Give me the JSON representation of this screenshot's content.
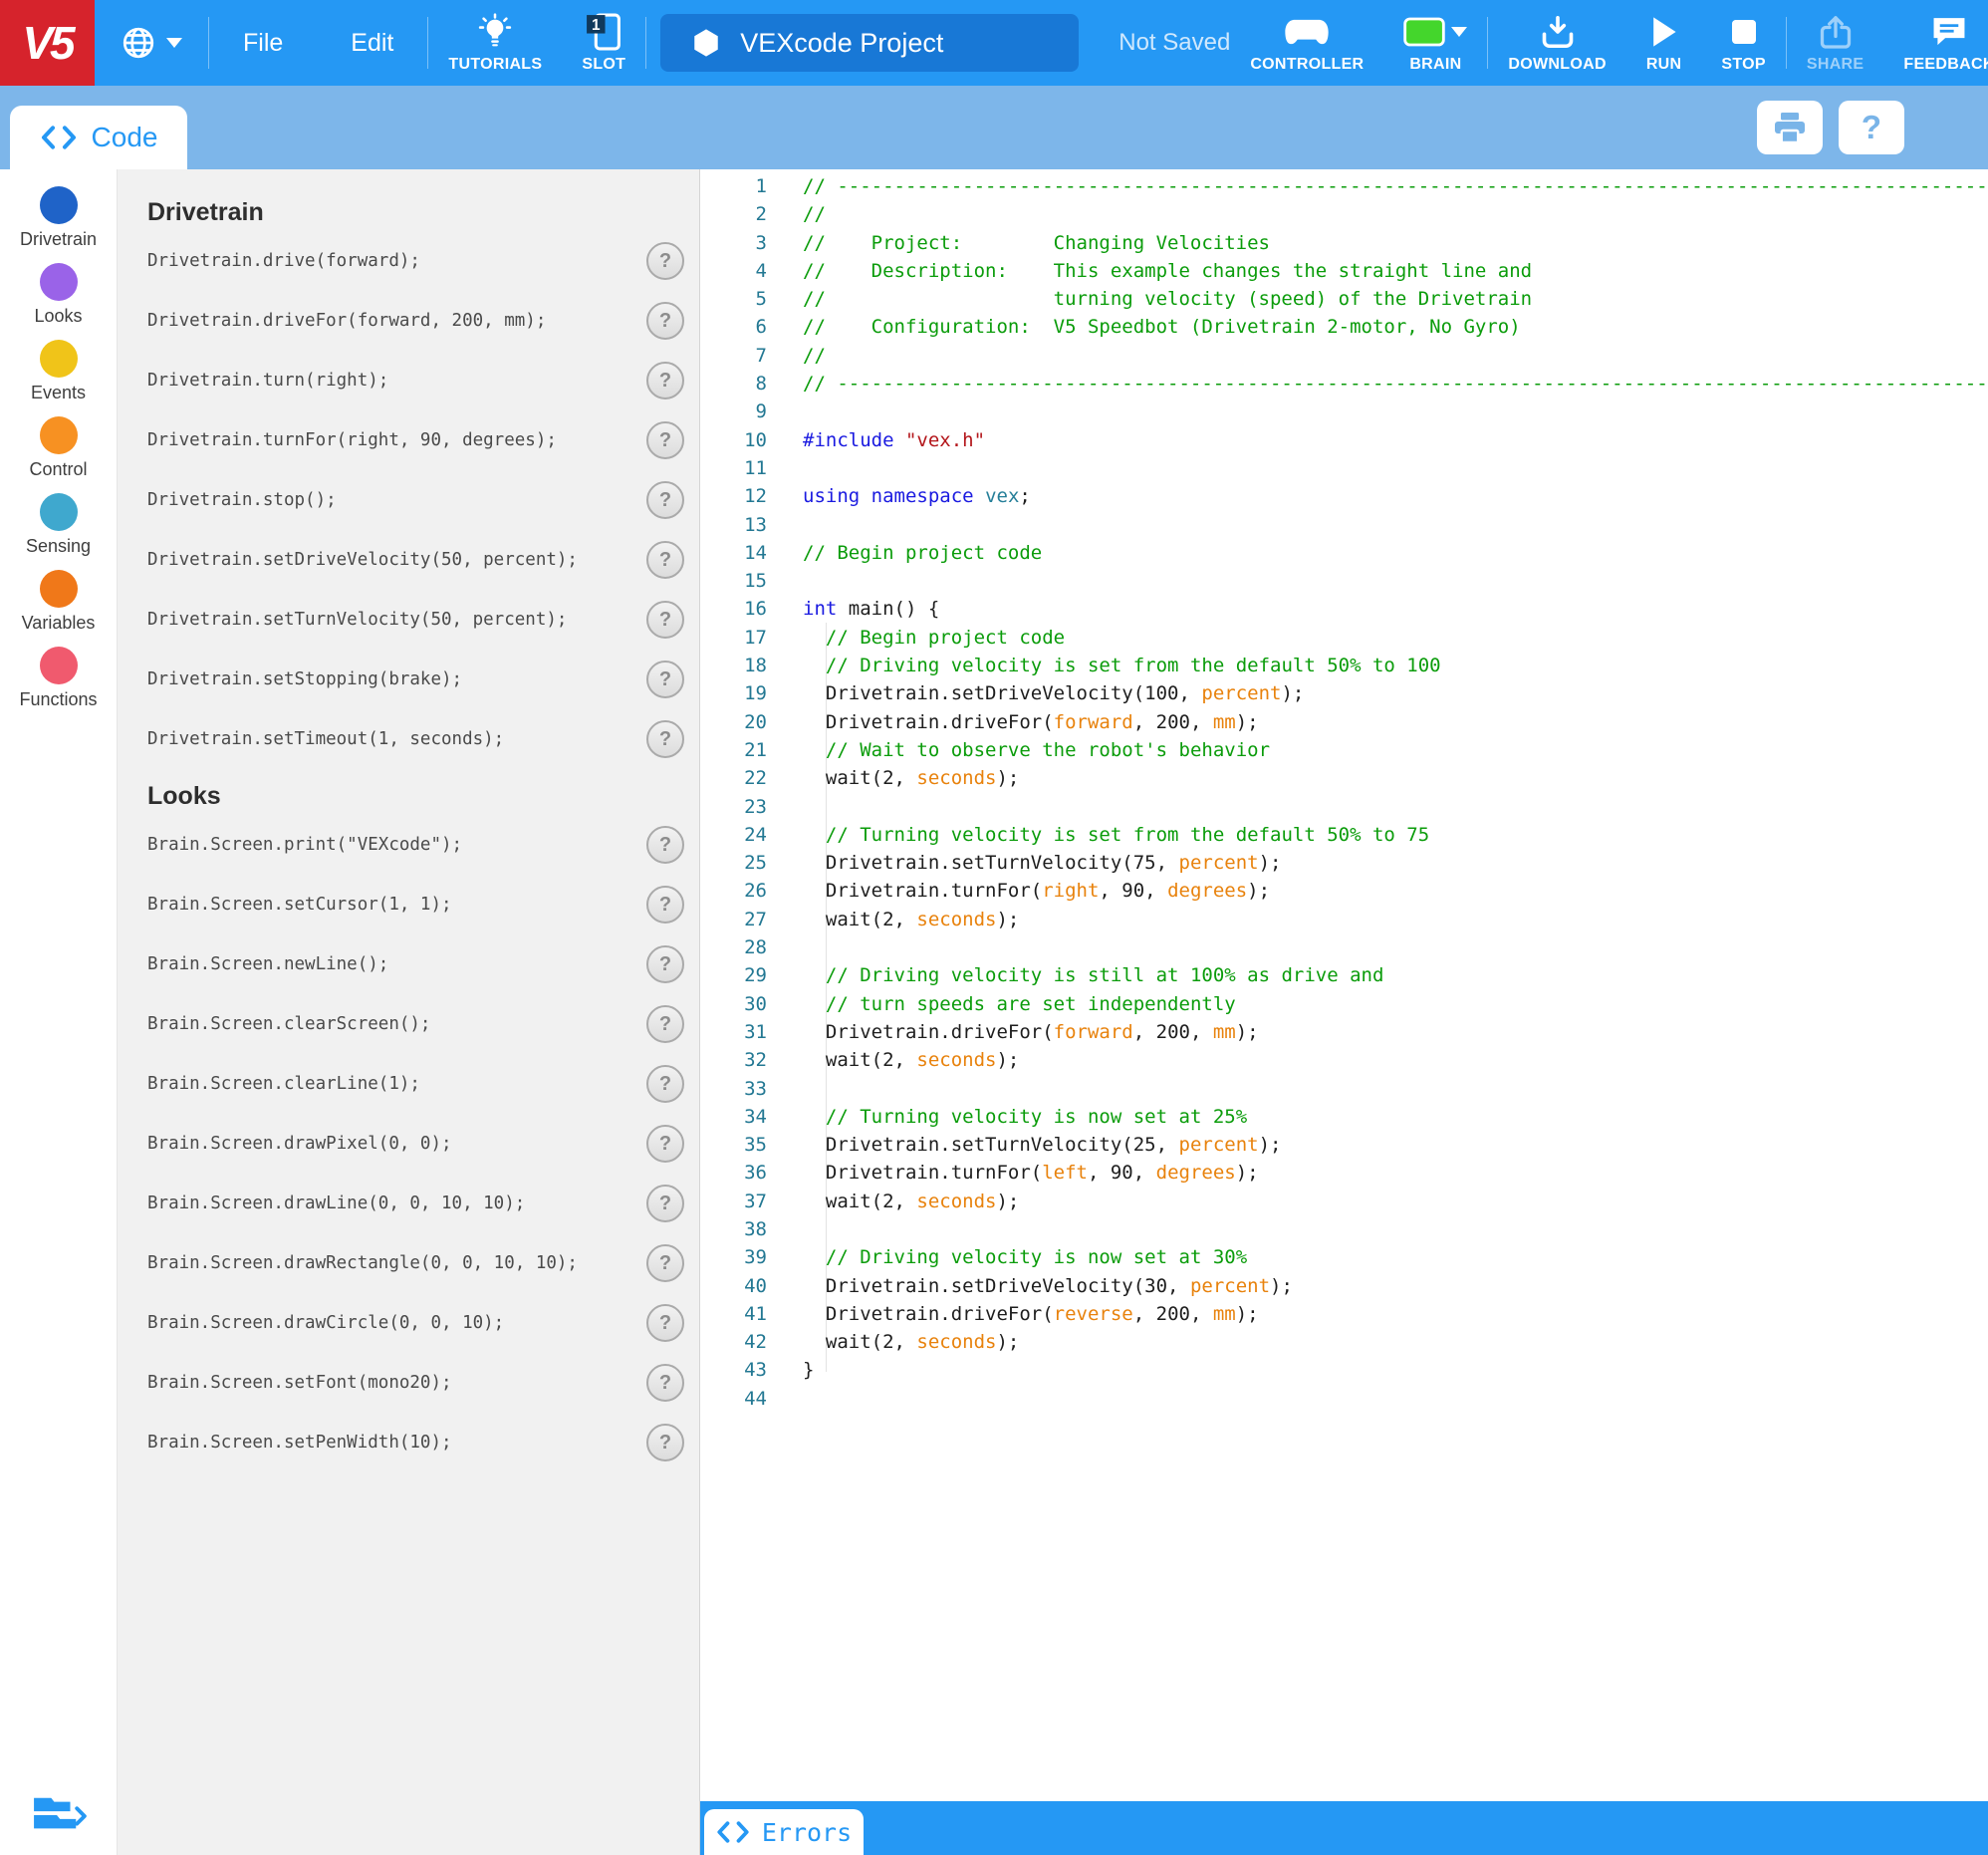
{
  "toolbar": {
    "logo": "V5",
    "menus": {
      "file": "File",
      "edit": "Edit"
    },
    "tutorials_label": "TUTORIALS",
    "slot": {
      "label": "SLOT",
      "number": "1"
    },
    "project": {
      "name": "VEXcode Project"
    },
    "save_status": "Not Saved",
    "controller_label": "CONTROLLER",
    "brain_label": "BRAIN",
    "download_label": "DOWNLOAD",
    "run_label": "RUN",
    "stop_label": "STOP",
    "share_label": "SHARE",
    "feedback_label": "FEEDBACK"
  },
  "tabs": {
    "code": "Code",
    "errors": "Errors"
  },
  "subbar": {
    "help_glyph": "?"
  },
  "sidebar": {
    "categories": [
      {
        "label": "Drivetrain",
        "color": "#1F63C8"
      },
      {
        "label": "Looks",
        "color": "#9A63E8"
      },
      {
        "label": "Events",
        "color": "#F0C419"
      },
      {
        "label": "Control",
        "color": "#F79122"
      },
      {
        "label": "Sensing",
        "color": "#3FA8CE"
      },
      {
        "label": "Variables",
        "color": "#F07819"
      },
      {
        "label": "Functions",
        "color": "#F05A6E"
      }
    ]
  },
  "command_panel": {
    "help_glyph": "?",
    "sections": [
      {
        "title": "Drivetrain",
        "commands": [
          "Drivetrain.drive(forward);",
          "Drivetrain.driveFor(forward, 200, mm);",
          "Drivetrain.turn(right);",
          "Drivetrain.turnFor(right, 90, degrees);",
          "Drivetrain.stop();",
          "Drivetrain.setDriveVelocity(50, percent);",
          "Drivetrain.setTurnVelocity(50, percent);",
          "Drivetrain.setStopping(brake);",
          "Drivetrain.setTimeout(1, seconds);"
        ]
      },
      {
        "title": "Looks",
        "commands": [
          "Brain.Screen.print(\"VEXcode\");",
          "Brain.Screen.setCursor(1, 1);",
          "Brain.Screen.newLine();",
          "Brain.Screen.clearScreen();",
          "Brain.Screen.clearLine(1);",
          "Brain.Screen.drawPixel(0, 0);",
          "Brain.Screen.drawLine(0, 0, 10, 10);",
          "Brain.Screen.drawRectangle(0, 0, 10, 10);",
          "Brain.Screen.drawCircle(0, 0, 10);",
          "Brain.Screen.setFont(mono20);",
          "Brain.Screen.setPenWidth(10);"
        ]
      }
    ]
  },
  "editor": {
    "lines": [
      {
        "n": 1,
        "t": [
          [
            "c",
            "// ------------------------------------------------------------------------------------------------------------------------"
          ]
        ]
      },
      {
        "n": 2,
        "t": [
          [
            "c",
            "//"
          ]
        ]
      },
      {
        "n": 3,
        "t": [
          [
            "c",
            "//    Project:        Changing Velocities"
          ]
        ]
      },
      {
        "n": 4,
        "t": [
          [
            "c",
            "//    Description:    This example changes the straight line and"
          ]
        ]
      },
      {
        "n": 5,
        "t": [
          [
            "c",
            "//                    turning velocity (speed) of the Drivetrain"
          ]
        ]
      },
      {
        "n": 6,
        "t": [
          [
            "c",
            "//    Configuration:  V5 Speedbot (Drivetrain 2-motor, No Gyro)"
          ]
        ]
      },
      {
        "n": 7,
        "t": [
          [
            "c",
            "//"
          ]
        ]
      },
      {
        "n": 8,
        "t": [
          [
            "c",
            "// ------------------------------------------------------------------------------------------------------------------------"
          ]
        ]
      },
      {
        "n": 9,
        "t": []
      },
      {
        "n": 10,
        "t": [
          [
            "k",
            "#include"
          ],
          [
            "p",
            " "
          ],
          [
            "s",
            "\"vex.h\""
          ]
        ]
      },
      {
        "n": 11,
        "t": []
      },
      {
        "n": 12,
        "t": [
          [
            "k",
            "using"
          ],
          [
            "p",
            " "
          ],
          [
            "k",
            "namespace"
          ],
          [
            "p",
            " "
          ],
          [
            "t",
            "vex"
          ],
          [
            "p",
            ";"
          ]
        ]
      },
      {
        "n": 13,
        "t": []
      },
      {
        "n": 14,
        "t": [
          [
            "c",
            "// Begin project code"
          ]
        ]
      },
      {
        "n": 15,
        "t": []
      },
      {
        "n": 16,
        "t": [
          [
            "k",
            "int"
          ],
          [
            "p",
            " main() {"
          ]
        ]
      },
      {
        "n": 17,
        "t": [
          [
            "p",
            "  "
          ],
          [
            "c",
            "// Begin project code"
          ]
        ]
      },
      {
        "n": 18,
        "t": [
          [
            "p",
            "  "
          ],
          [
            "c",
            "// Driving velocity is set from the default 50% to 100"
          ]
        ]
      },
      {
        "n": 19,
        "t": [
          [
            "p",
            "  Drivetrain.setDriveVelocity(100, "
          ],
          [
            "o",
            "percent"
          ],
          [
            "p",
            ");"
          ]
        ]
      },
      {
        "n": 20,
        "t": [
          [
            "p",
            "  Drivetrain.driveFor("
          ],
          [
            "o",
            "forward"
          ],
          [
            "p",
            ", 200, "
          ],
          [
            "o",
            "mm"
          ],
          [
            "p",
            ");"
          ]
        ]
      },
      {
        "n": 21,
        "t": [
          [
            "p",
            "  "
          ],
          [
            "c",
            "// Wait to observe the robot's behavior"
          ]
        ]
      },
      {
        "n": 22,
        "t": [
          [
            "p",
            "  wait(2, "
          ],
          [
            "o",
            "seconds"
          ],
          [
            "p",
            ");"
          ]
        ]
      },
      {
        "n": 23,
        "t": []
      },
      {
        "n": 24,
        "t": [
          [
            "p",
            "  "
          ],
          [
            "c",
            "// Turning velocity is set from the default 50% to 75"
          ]
        ]
      },
      {
        "n": 25,
        "t": [
          [
            "p",
            "  Drivetrain.setTurnVelocity(75, "
          ],
          [
            "o",
            "percent"
          ],
          [
            "p",
            ");"
          ]
        ]
      },
      {
        "n": 26,
        "t": [
          [
            "p",
            "  Drivetrain.turnFor("
          ],
          [
            "o",
            "right"
          ],
          [
            "p",
            ", 90, "
          ],
          [
            "o",
            "degrees"
          ],
          [
            "p",
            ");"
          ]
        ]
      },
      {
        "n": 27,
        "t": [
          [
            "p",
            "  wait(2, "
          ],
          [
            "o",
            "seconds"
          ],
          [
            "p",
            ");"
          ]
        ]
      },
      {
        "n": 28,
        "t": []
      },
      {
        "n": 29,
        "t": [
          [
            "p",
            "  "
          ],
          [
            "c",
            "// Driving velocity is still at 100% as drive and"
          ]
        ]
      },
      {
        "n": 30,
        "t": [
          [
            "p",
            "  "
          ],
          [
            "c",
            "// turn speeds are set independently"
          ]
        ]
      },
      {
        "n": 31,
        "t": [
          [
            "p",
            "  Drivetrain.driveFor("
          ],
          [
            "o",
            "forward"
          ],
          [
            "p",
            ", 200, "
          ],
          [
            "o",
            "mm"
          ],
          [
            "p",
            ");"
          ]
        ]
      },
      {
        "n": 32,
        "t": [
          [
            "p",
            "  wait(2, "
          ],
          [
            "o",
            "seconds"
          ],
          [
            "p",
            ");"
          ]
        ]
      },
      {
        "n": 33,
        "t": []
      },
      {
        "n": 34,
        "t": [
          [
            "p",
            "  "
          ],
          [
            "c",
            "// Turning velocity is now set at 25%"
          ]
        ]
      },
      {
        "n": 35,
        "t": [
          [
            "p",
            "  Drivetrain.setTurnVelocity(25, "
          ],
          [
            "o",
            "percent"
          ],
          [
            "p",
            ");"
          ]
        ]
      },
      {
        "n": 36,
        "t": [
          [
            "p",
            "  Drivetrain.turnFor("
          ],
          [
            "o",
            "left"
          ],
          [
            "p",
            ", 90, "
          ],
          [
            "o",
            "degrees"
          ],
          [
            "p",
            ");"
          ]
        ]
      },
      {
        "n": 37,
        "t": [
          [
            "p",
            "  wait(2, "
          ],
          [
            "o",
            "seconds"
          ],
          [
            "p",
            ");"
          ]
        ]
      },
      {
        "n": 38,
        "t": []
      },
      {
        "n": 39,
        "t": [
          [
            "p",
            "  "
          ],
          [
            "c",
            "// Driving velocity is now set at 30%"
          ]
        ]
      },
      {
        "n": 40,
        "t": [
          [
            "p",
            "  Drivetrain.setDriveVelocity(30, "
          ],
          [
            "o",
            "percent"
          ],
          [
            "p",
            ");"
          ]
        ]
      },
      {
        "n": 41,
        "t": [
          [
            "p",
            "  Drivetrain.driveFor("
          ],
          [
            "o",
            "reverse"
          ],
          [
            "p",
            ", 200, "
          ],
          [
            "o",
            "mm"
          ],
          [
            "p",
            ");"
          ]
        ]
      },
      {
        "n": 42,
        "t": [
          [
            "p",
            "  wait(2, "
          ],
          [
            "o",
            "seconds"
          ],
          [
            "p",
            ");"
          ]
        ]
      },
      {
        "n": 43,
        "t": [
          [
            "p",
            "}"
          ]
        ]
      },
      {
        "n": 44,
        "t": []
      }
    ]
  },
  "colors": {
    "toolbar_blue": "#2598F4",
    "subbar_blue": "#7DB6EA",
    "brand_red": "#D6232C",
    "project_pill_blue": "#1878D6",
    "brain_green": "#44D62C",
    "accent_blue": "#2598F4",
    "syntax": {
      "comment": "#0B9C0B",
      "keyword": "#1A1AE0",
      "string": "#B3151A",
      "constant": "#E8820C",
      "namespace": "#267F99",
      "plain": "#1E1E1E",
      "line_number": "#237893"
    }
  }
}
